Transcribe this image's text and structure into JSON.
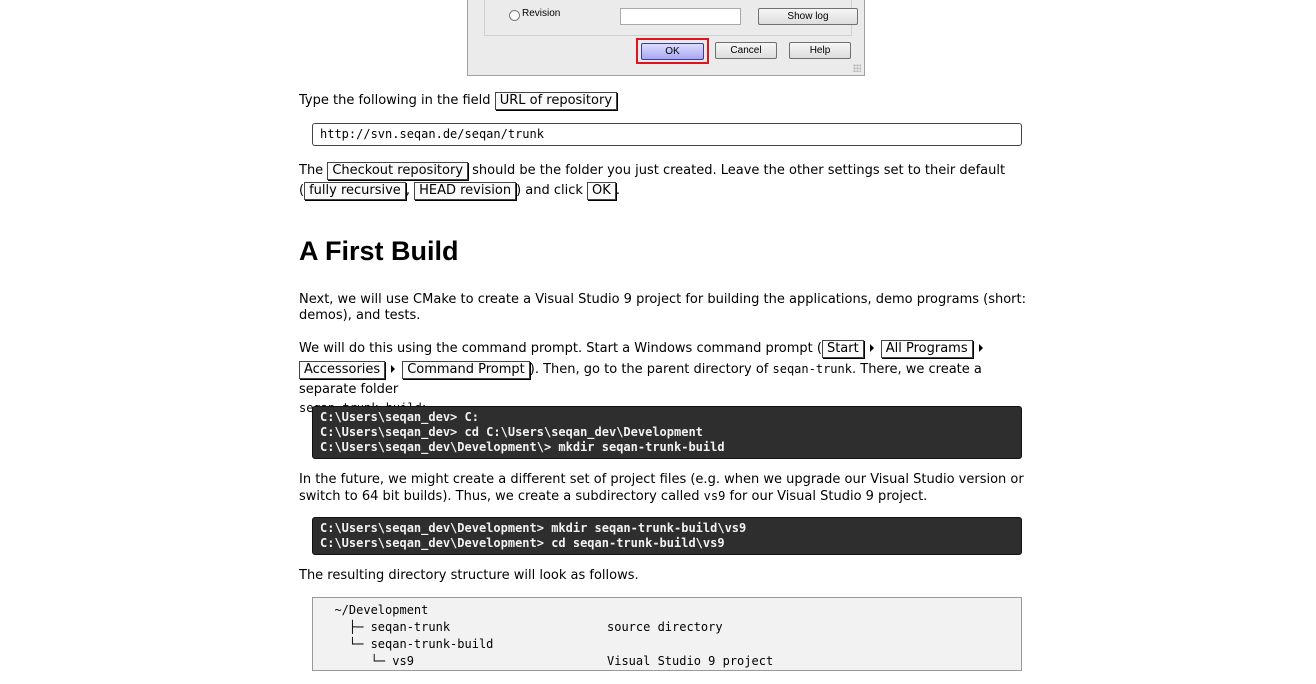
{
  "dialog": {
    "revision_label": "Revision",
    "show_log": "Show log",
    "ok": "OK",
    "cancel": "Cancel",
    "help": "Help"
  },
  "intro": {
    "prefix": "Type the following in the field",
    "field": "URL of repository"
  },
  "url": "http://svn.seqan.de/seqan/trunk",
  "checkout": {
    "pre": "The",
    "field": "Checkout repository",
    "mid": "should be the folder you just created. Leave the other settings set to their default",
    "open": "(",
    "opt1": "fully recursive",
    "comma": ",",
    "opt2": "HEAD revision",
    "click": ") and click",
    "ok": "OK",
    "end": "."
  },
  "heading": "A First Build",
  "para1": "Next, we will use CMake to create a Visual Studio 9 project for building the applications, demo programs (short: demos), and tests.",
  "para2": {
    "text1": "We will do this using the command prompt. Start a Windows command prompt (",
    "menu": [
      "Start",
      "All Programs",
      "Accessories",
      "Command Prompt"
    ],
    "text2": "). Then, go to the parent directory of",
    "dir1": "seqan-trunk",
    "text3": ". There, we create a separate folder",
    "dir2": "seqan-trunk-build",
    "text4": ":"
  },
  "term1": [
    "C:\\Users\\seqan_dev> C:",
    "C:\\Users\\seqan_dev> cd C:\\Users\\seqan_dev\\Development",
    "C:\\Users\\seqan_dev\\Development\\> mkdir seqan-trunk-build"
  ],
  "para3": {
    "text1": "In the future, we might create a different set of project files (e.g. when we upgrade our Visual Studio version or switch to 64 bit builds). Thus, we create a subdirectory called",
    "code": "vs9",
    "text2": "for our Visual Studio 9 project."
  },
  "term2": [
    "C:\\Users\\seqan_dev\\Development> mkdir seqan-trunk-build\\vs9",
    "C:\\Users\\seqan_dev\\Development> cd seqan-trunk-build\\vs9"
  ],
  "para4": "The resulting directory structure will look as follows.",
  "tree": [
    {
      "path": "  ~/Development",
      "desc": ""
    },
    {
      "path": "    ├─ seqan-trunk",
      "desc": "source directory"
    },
    {
      "path": "    └─ seqan-trunk-build",
      "desc": ""
    },
    {
      "path": "       └─ vs9",
      "desc": "Visual Studio 9 project"
    }
  ]
}
